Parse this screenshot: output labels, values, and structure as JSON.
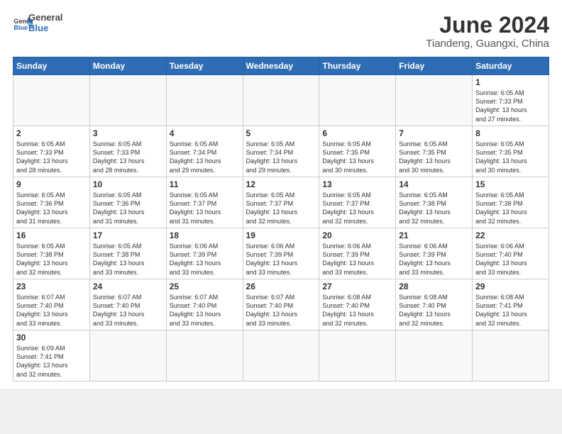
{
  "header": {
    "logo_general": "General",
    "logo_blue": "Blue",
    "title": "June 2024",
    "location": "Tiandeng, Guangxi, China"
  },
  "weekdays": [
    "Sunday",
    "Monday",
    "Tuesday",
    "Wednesday",
    "Thursday",
    "Friday",
    "Saturday"
  ],
  "weeks": [
    [
      {
        "day": "",
        "info": ""
      },
      {
        "day": "",
        "info": ""
      },
      {
        "day": "",
        "info": ""
      },
      {
        "day": "",
        "info": ""
      },
      {
        "day": "",
        "info": ""
      },
      {
        "day": "",
        "info": ""
      },
      {
        "day": "1",
        "info": "Sunrise: 6:05 AM\nSunset: 7:33 PM\nDaylight: 13 hours\nand 27 minutes."
      }
    ],
    [
      {
        "day": "2",
        "info": "Sunrise: 6:05 AM\nSunset: 7:33 PM\nDaylight: 13 hours\nand 28 minutes."
      },
      {
        "day": "3",
        "info": "Sunrise: 6:05 AM\nSunset: 7:33 PM\nDaylight: 13 hours\nand 28 minutes."
      },
      {
        "day": "4",
        "info": "Sunrise: 6:05 AM\nSunset: 7:34 PM\nDaylight: 13 hours\nand 29 minutes."
      },
      {
        "day": "5",
        "info": "Sunrise: 6:05 AM\nSunset: 7:34 PM\nDaylight: 13 hours\nand 29 minutes."
      },
      {
        "day": "6",
        "info": "Sunrise: 6:05 AM\nSunset: 7:35 PM\nDaylight: 13 hours\nand 30 minutes."
      },
      {
        "day": "7",
        "info": "Sunrise: 6:05 AM\nSunset: 7:35 PM\nDaylight: 13 hours\nand 30 minutes."
      },
      {
        "day": "8",
        "info": "Sunrise: 6:05 AM\nSunset: 7:35 PM\nDaylight: 13 hours\nand 30 minutes."
      }
    ],
    [
      {
        "day": "9",
        "info": "Sunrise: 6:05 AM\nSunset: 7:36 PM\nDaylight: 13 hours\nand 31 minutes."
      },
      {
        "day": "10",
        "info": "Sunrise: 6:05 AM\nSunset: 7:36 PM\nDaylight: 13 hours\nand 31 minutes."
      },
      {
        "day": "11",
        "info": "Sunrise: 6:05 AM\nSunset: 7:37 PM\nDaylight: 13 hours\nand 31 minutes."
      },
      {
        "day": "12",
        "info": "Sunrise: 6:05 AM\nSunset: 7:37 PM\nDaylight: 13 hours\nand 32 minutes."
      },
      {
        "day": "13",
        "info": "Sunrise: 6:05 AM\nSunset: 7:37 PM\nDaylight: 13 hours\nand 32 minutes."
      },
      {
        "day": "14",
        "info": "Sunrise: 6:05 AM\nSunset: 7:38 PM\nDaylight: 13 hours\nand 32 minutes."
      },
      {
        "day": "15",
        "info": "Sunrise: 6:05 AM\nSunset: 7:38 PM\nDaylight: 13 hours\nand 32 minutes."
      }
    ],
    [
      {
        "day": "16",
        "info": "Sunrise: 6:05 AM\nSunset: 7:38 PM\nDaylight: 13 hours\nand 32 minutes."
      },
      {
        "day": "17",
        "info": "Sunrise: 6:05 AM\nSunset: 7:38 PM\nDaylight: 13 hours\nand 33 minutes."
      },
      {
        "day": "18",
        "info": "Sunrise: 6:06 AM\nSunset: 7:39 PM\nDaylight: 13 hours\nand 33 minutes."
      },
      {
        "day": "19",
        "info": "Sunrise: 6:06 AM\nSunset: 7:39 PM\nDaylight: 13 hours\nand 33 minutes."
      },
      {
        "day": "20",
        "info": "Sunrise: 6:06 AM\nSunset: 7:39 PM\nDaylight: 13 hours\nand 33 minutes."
      },
      {
        "day": "21",
        "info": "Sunrise: 6:06 AM\nSunset: 7:39 PM\nDaylight: 13 hours\nand 33 minutes."
      },
      {
        "day": "22",
        "info": "Sunrise: 6:06 AM\nSunset: 7:40 PM\nDaylight: 13 hours\nand 33 minutes."
      }
    ],
    [
      {
        "day": "23",
        "info": "Sunrise: 6:07 AM\nSunset: 7:40 PM\nDaylight: 13 hours\nand 33 minutes."
      },
      {
        "day": "24",
        "info": "Sunrise: 6:07 AM\nSunset: 7:40 PM\nDaylight: 13 hours\nand 33 minutes."
      },
      {
        "day": "25",
        "info": "Sunrise: 6:07 AM\nSunset: 7:40 PM\nDaylight: 13 hours\nand 33 minutes."
      },
      {
        "day": "26",
        "info": "Sunrise: 6:07 AM\nSunset: 7:40 PM\nDaylight: 13 hours\nand 33 minutes."
      },
      {
        "day": "27",
        "info": "Sunrise: 6:08 AM\nSunset: 7:40 PM\nDaylight: 13 hours\nand 32 minutes."
      },
      {
        "day": "28",
        "info": "Sunrise: 6:08 AM\nSunset: 7:40 PM\nDaylight: 13 hours\nand 32 minutes."
      },
      {
        "day": "29",
        "info": "Sunrise: 6:08 AM\nSunset: 7:41 PM\nDaylight: 13 hours\nand 32 minutes."
      }
    ],
    [
      {
        "day": "30",
        "info": "Sunrise: 6:09 AM\nSunset: 7:41 PM\nDaylight: 13 hours\nand 32 minutes."
      },
      {
        "day": "",
        "info": ""
      },
      {
        "day": "",
        "info": ""
      },
      {
        "day": "",
        "info": ""
      },
      {
        "day": "",
        "info": ""
      },
      {
        "day": "",
        "info": ""
      },
      {
        "day": "",
        "info": ""
      }
    ]
  ]
}
